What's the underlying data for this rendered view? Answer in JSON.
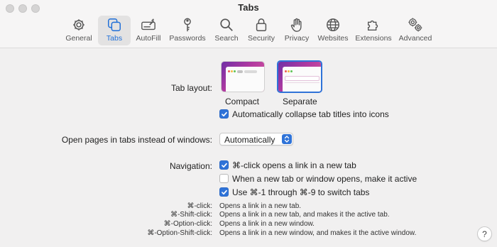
{
  "window": {
    "title": "Tabs"
  },
  "colors": {
    "accent": "#2f73d8",
    "wallpaper": "#a43aa4"
  },
  "toolbar": {
    "tabs": [
      {
        "label": "General",
        "icon": "gear-icon"
      },
      {
        "label": "Tabs",
        "icon": "tabs-icon",
        "active": true
      },
      {
        "label": "AutoFill",
        "icon": "autofill-icon"
      },
      {
        "label": "Passwords",
        "icon": "key-icon"
      },
      {
        "label": "Search",
        "icon": "magnifier-icon"
      },
      {
        "label": "Security",
        "icon": "lock-icon"
      },
      {
        "label": "Privacy",
        "icon": "hand-icon"
      },
      {
        "label": "Websites",
        "icon": "globe-icon"
      },
      {
        "label": "Extensions",
        "icon": "extensions-icon"
      },
      {
        "label": "Advanced",
        "icon": "gears-icon"
      }
    ]
  },
  "tab_layout": {
    "label": "Tab layout:",
    "options": [
      {
        "label": "Compact",
        "selected": false
      },
      {
        "label": "Separate",
        "selected": true
      }
    ],
    "collapse_checkbox": {
      "label": "Automatically collapse tab titles into icons",
      "checked": true
    }
  },
  "open_pages": {
    "label": "Open pages in tabs instead of windows:",
    "value": "Automatically"
  },
  "navigation": {
    "label": "Navigation:",
    "checkboxes": [
      {
        "label": "⌘-click opens a link in a new tab",
        "checked": true
      },
      {
        "label": "When a new tab or window opens, make it active",
        "checked": false
      },
      {
        "label": "Use ⌘-1 through ⌘-9 to switch tabs",
        "checked": true
      }
    ]
  },
  "shortcuts": [
    {
      "key": "⌘-click:",
      "desc": "Opens a link in a new tab."
    },
    {
      "key": "⌘-Shift-click:",
      "desc": "Opens a link in a new tab, and makes it the active tab."
    },
    {
      "key": "⌘-Option-click:",
      "desc": "Opens a link in a new window."
    },
    {
      "key": "⌘-Option-Shift-click:",
      "desc": "Opens a link in a new window, and makes it the active window."
    }
  ],
  "help": {
    "label": "?"
  }
}
